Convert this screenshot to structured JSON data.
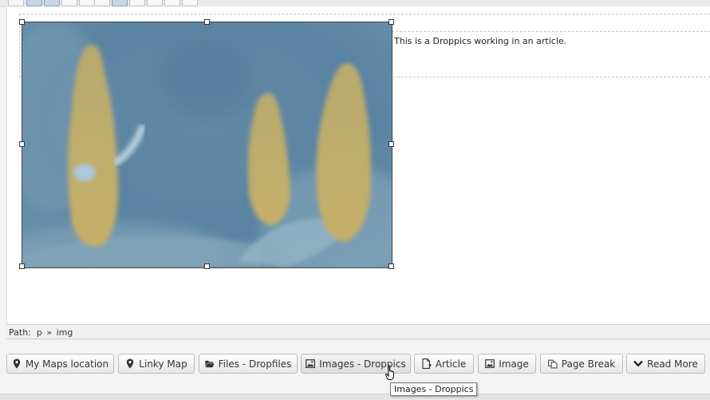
{
  "editor": {
    "paragraph_text": "This is a Droppics working in an article."
  },
  "pathbar": {
    "label": "Path:",
    "items": [
      "p",
      "img"
    ],
    "separator": "»"
  },
  "buttons": [
    {
      "label": "My Maps location",
      "icon": "map-marker-icon"
    },
    {
      "label": "Linky Map",
      "icon": "map-marker-icon"
    },
    {
      "label": "Files - Dropfiles",
      "icon": "folder-open-icon"
    },
    {
      "label": "Images - Droppics",
      "icon": "picture-icon"
    },
    {
      "label": "Article",
      "icon": "file-add-icon"
    },
    {
      "label": "Image",
      "icon": "picture-icon"
    },
    {
      "label": "Page Break",
      "icon": "copy-icon"
    },
    {
      "label": "Read More",
      "icon": "chevron-down-icon"
    }
  ],
  "tooltip": {
    "text": "Images - Droppics"
  },
  "colors": {
    "image_tint": "#6f93ad",
    "flower": "#d8b45a"
  }
}
